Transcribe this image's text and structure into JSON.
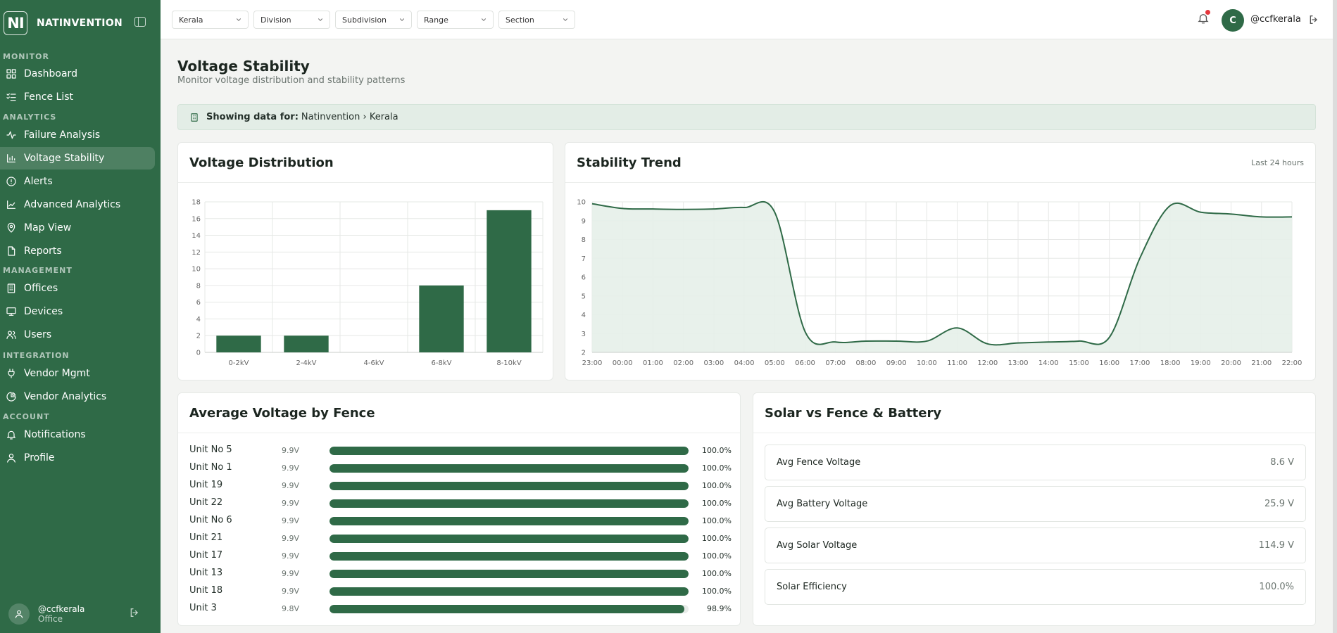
{
  "brand": {
    "logo_text": "NI",
    "name": "NATINVENTION"
  },
  "sidebar": {
    "sections": [
      {
        "label": "MONITOR",
        "items": [
          {
            "label": "Dashboard",
            "icon": "grid-icon"
          },
          {
            "label": "Fence List",
            "icon": "list-check-icon"
          }
        ]
      },
      {
        "label": "ANALYTICS",
        "items": [
          {
            "label": "Failure Analysis",
            "icon": "activity-icon"
          },
          {
            "label": "Voltage Stability",
            "icon": "bar-chart-icon",
            "active": true
          },
          {
            "label": "Alerts",
            "icon": "alert-circle-icon"
          },
          {
            "label": "Advanced Analytics",
            "icon": "line-chart-icon"
          },
          {
            "label": "Map View",
            "icon": "map-pin-icon"
          },
          {
            "label": "Reports",
            "icon": "file-icon"
          }
        ]
      },
      {
        "label": "MANAGEMENT",
        "items": [
          {
            "label": "Offices",
            "icon": "building-icon"
          },
          {
            "label": "Devices",
            "icon": "monitor-icon"
          },
          {
            "label": "Users",
            "icon": "users-icon"
          }
        ]
      },
      {
        "label": "INTEGRATION",
        "items": [
          {
            "label": "Vendor Mgmt",
            "icon": "plug-icon"
          },
          {
            "label": "Vendor Analytics",
            "icon": "pie-chart-icon"
          }
        ]
      },
      {
        "label": "ACCOUNT",
        "items": [
          {
            "label": "Notifications",
            "icon": "bell-icon"
          },
          {
            "label": "Profile",
            "icon": "user-icon"
          }
        ]
      }
    ],
    "user": {
      "name": "@ccfkerala",
      "role": "Office"
    }
  },
  "topbar": {
    "filters": [
      "Kerala",
      "Division",
      "Subdivision",
      "Range",
      "Section"
    ],
    "avatar_letter": "C",
    "username": "@ccfkerala"
  },
  "page": {
    "title": "Voltage Stability",
    "subtitle": "Monitor voltage distribution and stability patterns"
  },
  "banner": {
    "label": "Showing data for:",
    "value": "Natinvention › Kerala"
  },
  "distribution_card": {
    "title": "Voltage Distribution"
  },
  "trend_card": {
    "title": "Stability Trend",
    "note": "Last 24 hours"
  },
  "fence_card": {
    "title": "Average Voltage by Fence",
    "rows": [
      {
        "name": "Unit No 5",
        "voltage": "9.9V",
        "pct": "100.0%",
        "fill": 100
      },
      {
        "name": "Unit No 1",
        "voltage": "9.9V",
        "pct": "100.0%",
        "fill": 100
      },
      {
        "name": "Unit 19",
        "voltage": "9.9V",
        "pct": "100.0%",
        "fill": 100
      },
      {
        "name": "Unit 22",
        "voltage": "9.9V",
        "pct": "100.0%",
        "fill": 100
      },
      {
        "name": "Unit No 6",
        "voltage": "9.9V",
        "pct": "100.0%",
        "fill": 100
      },
      {
        "name": "Unit 21",
        "voltage": "9.9V",
        "pct": "100.0%",
        "fill": 100
      },
      {
        "name": "Unit 17",
        "voltage": "9.9V",
        "pct": "100.0%",
        "fill": 100
      },
      {
        "name": "Unit 13",
        "voltage": "9.9V",
        "pct": "100.0%",
        "fill": 100
      },
      {
        "name": "Unit 18",
        "voltage": "9.9V",
        "pct": "100.0%",
        "fill": 100
      },
      {
        "name": "Unit 3",
        "voltage": "9.8V",
        "pct": "98.9%",
        "fill": 98.9
      }
    ]
  },
  "solar_card": {
    "title": "Solar vs Fence & Battery",
    "stats": [
      {
        "label": "Avg Fence Voltage",
        "value": "8.6 V"
      },
      {
        "label": "Avg Battery Voltage",
        "value": "25.9 V"
      },
      {
        "label": "Avg Solar Voltage",
        "value": "114.9 V"
      },
      {
        "label": "Solar Efficiency",
        "value": "100.0%"
      }
    ]
  },
  "colors": {
    "primary": "#2f6a47",
    "notification_dot": "#e5373d",
    "area_fill": "#e6efe9"
  },
  "chart_data": [
    {
      "type": "bar",
      "title": "Voltage Distribution",
      "categories": [
        "0-2kV",
        "2-4kV",
        "4-6kV",
        "6-8kV",
        "8-10kV"
      ],
      "values": [
        2,
        2,
        0,
        8,
        17
      ],
      "ylim": [
        0,
        18
      ],
      "yticks": [
        0,
        2,
        4,
        6,
        8,
        10,
        12,
        14,
        16,
        18
      ],
      "grid": true
    },
    {
      "type": "area",
      "title": "Stability Trend",
      "categories": [
        "23:00",
        "00:00",
        "01:00",
        "02:00",
        "03:00",
        "04:00",
        "05:00",
        "06:00",
        "07:00",
        "08:00",
        "09:00",
        "10:00",
        "11:00",
        "12:00",
        "13:00",
        "14:00",
        "15:00",
        "16:00",
        "17:00",
        "18:00",
        "19:00",
        "20:00",
        "21:00",
        "22:00"
      ],
      "values": [
        9.9,
        9.65,
        9.62,
        9.6,
        9.62,
        9.7,
        9.45,
        3.1,
        2.55,
        2.6,
        2.6,
        2.6,
        3.3,
        2.45,
        2.5,
        2.55,
        2.6,
        2.8,
        7.0,
        9.8,
        9.45,
        9.35,
        9.2,
        9.2
      ],
      "ylim": [
        2,
        10
      ],
      "yticks": [
        2,
        3,
        4,
        5,
        6,
        7,
        8,
        9,
        10
      ],
      "grid": true
    }
  ]
}
